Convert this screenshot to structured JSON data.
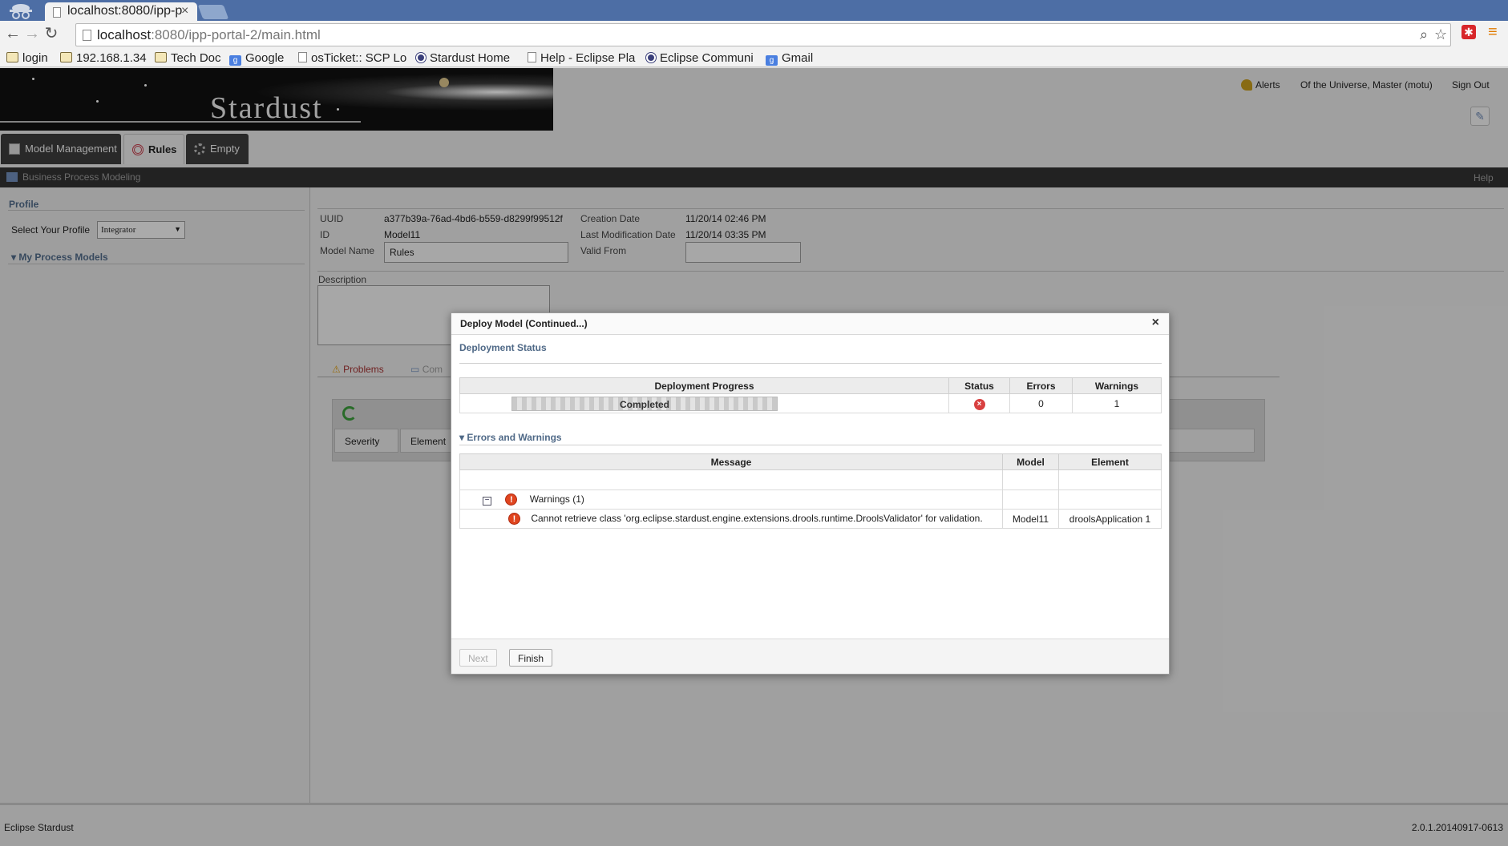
{
  "browser": {
    "tab_title": "localhost:8080/ipp-p",
    "url_host": "localhost",
    "url_rest": ":8080/ipp-portal-2/main.html",
    "bookmarks": [
      {
        "label": "login",
        "icon": "folder-icon"
      },
      {
        "label": "192.168.1.34",
        "icon": "folder-icon"
      },
      {
        "label": "Tech Doc",
        "icon": "folder-icon"
      },
      {
        "label": "Google",
        "icon": "google-icon"
      },
      {
        "label": "osTicket:: SCP Lo",
        "icon": "page-icon"
      },
      {
        "label": "Stardust Home",
        "icon": "eclipse-icon"
      },
      {
        "label": "Help - Eclipse Pla",
        "icon": "page-icon"
      },
      {
        "label": "Eclipse Communi",
        "icon": "eclipse-icon"
      },
      {
        "label": "Gmail",
        "icon": "google-icon"
      }
    ]
  },
  "header": {
    "logo": "Stardust",
    "alerts": "Alerts",
    "user": "Of the Universe, Master (motu)",
    "sign_out": "Sign Out"
  },
  "perspectives": [
    {
      "label": "Model Management"
    },
    {
      "label": "Rules"
    },
    {
      "label": "Empty"
    }
  ],
  "subbar": {
    "title": "Business Process Modeling",
    "help": "Help"
  },
  "sidebar": {
    "profile_title": "Profile",
    "select_label": "Select Your Profile",
    "select_value": "Integrator",
    "models_title": "My Process Models"
  },
  "props": {
    "uuid_label": "UUID",
    "uuid": "a377b39a-76ad-4bd6-b559-d8299f99512f",
    "id_label": "ID",
    "id": "Model11",
    "name_label": "Model Name",
    "name": "Rules",
    "created_label": "Creation Date",
    "created": "11/20/14 02:46 PM",
    "modified_label": "Last Modification Date",
    "modified": "11/20/14 03:35 PM",
    "valid_label": "Valid From",
    "valid": "",
    "desc_label": "Description",
    "problems_tab": "Problems",
    "comments_tab": "Com",
    "col_severity": "Severity",
    "col_element": "Element"
  },
  "footer": {
    "left": "Eclipse Stardust",
    "right": "2.0.1.20140917-0613"
  },
  "dialog": {
    "title": "Deploy Model (Continued...)",
    "status_section": "Deployment Status",
    "status_headers": [
      "Deployment Progress",
      "Status",
      "Errors",
      "Warnings"
    ],
    "progress_label": "Completed",
    "progress_fraction": 1.0,
    "errors": "0",
    "warnings": "1",
    "errors_section": "Errors and Warnings",
    "msg_headers": [
      "Message",
      "Model",
      "Element"
    ],
    "group_label": "Warnings (1)",
    "message": "Cannot retrieve class 'org.eclipse.stardust.engine.extensions.drools.runtime.DroolsValidator' for validation.",
    "message_model": "Model11",
    "message_element": "droolsApplication 1",
    "next": "Next",
    "finish": "Finish"
  },
  "colors": {
    "section_title": "#4f6987",
    "tabstrip": "#4d6ea5",
    "error": "#d84040"
  }
}
